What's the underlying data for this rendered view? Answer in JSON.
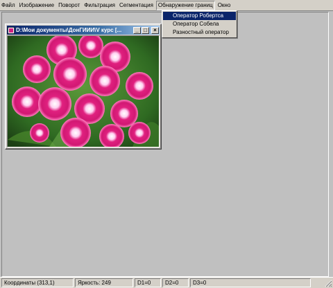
{
  "menu": {
    "items": [
      "Файл",
      "Изображение",
      "Поворот",
      "Фильтрация",
      "Сегментация",
      "Обнаружение границ",
      "Окно"
    ],
    "open_index": 5
  },
  "dropdown": {
    "items": [
      "Оператор Робертса",
      "Оператор Собела",
      "Разностный оператор"
    ],
    "selected_index": 0
  },
  "child_window": {
    "title": "D:\\Мои документы\\ДонГИИИ\\V курс [...",
    "buttons": {
      "minimize": "_",
      "maximize": "□",
      "close": "×"
    },
    "image": "pink-carnation-flowers-photo"
  },
  "status": {
    "coords": "Координаты (313,1)",
    "brightness": "Яркость: 249",
    "d1": "D1=0",
    "d2": "D2=0",
    "d3": "D3=0"
  },
  "colors": {
    "face": "#d4d0c8",
    "workspace": "#c0c0c0",
    "title_active": "#0a246a",
    "highlight": "#0a246a"
  }
}
